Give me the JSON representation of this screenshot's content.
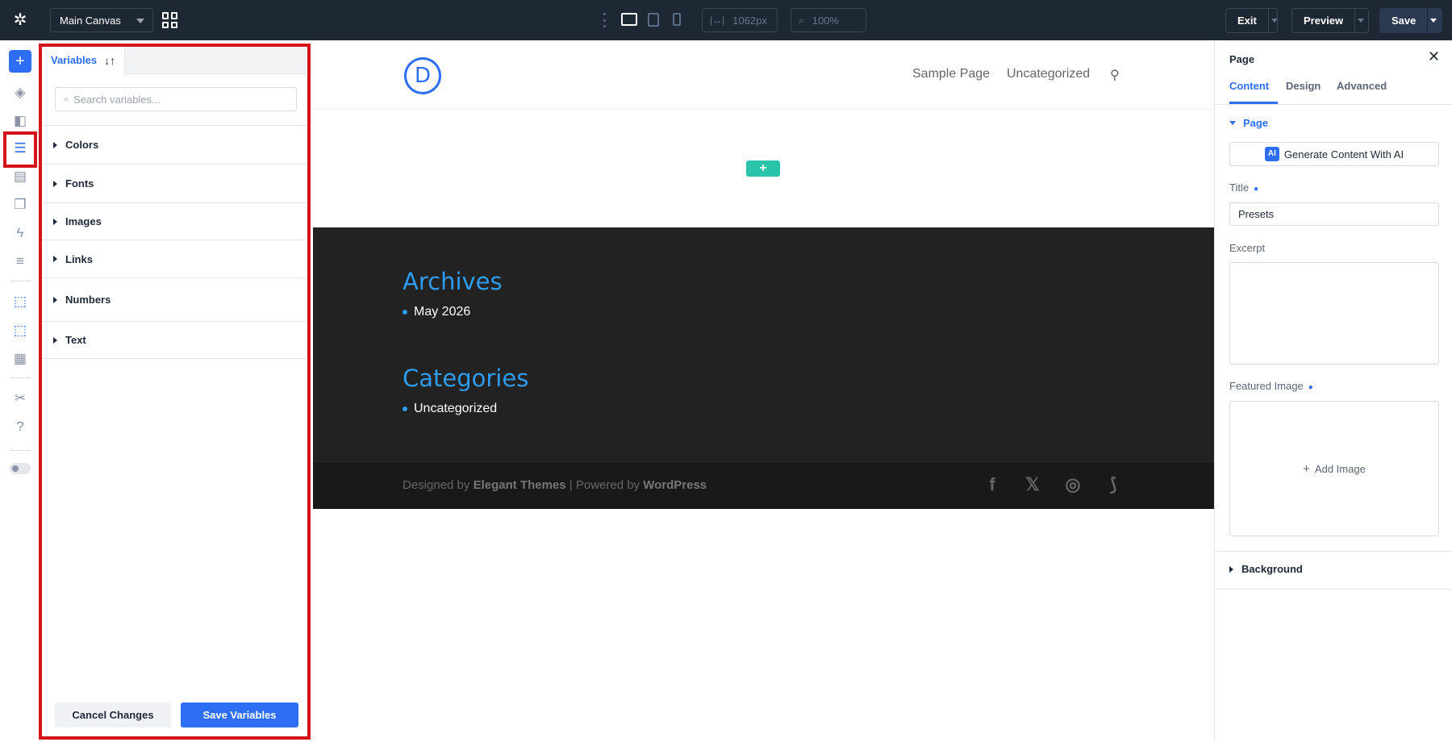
{
  "topbar": {
    "canvas_label": "Main Canvas",
    "width_value": "1062px",
    "zoom_value": "100%",
    "exit_label": "Exit",
    "preview_label": "Preview",
    "save_label": "Save"
  },
  "variables_panel": {
    "tab_label": "Variables",
    "search_placeholder": "Search variables...",
    "sections": [
      "Colors",
      "Fonts",
      "Images",
      "Links",
      "Numbers",
      "Text"
    ],
    "cancel_label": "Cancel Changes",
    "save_label": "Save Variables"
  },
  "preview": {
    "logo_letter": "D",
    "nav": [
      "Sample Page",
      "Uncategorized"
    ],
    "widgets": [
      {
        "title": "Archives",
        "items": [
          "May 2026"
        ]
      },
      {
        "title": "Categories",
        "items": [
          "Uncategorized"
        ]
      }
    ],
    "credits": {
      "designed_by": "Designed by ",
      "theme": "Elegant Themes",
      "powered_by": " | Powered by ",
      "platform": "WordPress"
    }
  },
  "settings": {
    "title": "Page",
    "tabs": [
      "Content",
      "Design",
      "Advanced"
    ],
    "group_title": "Page",
    "ai_badge": "AI",
    "ai_button": "Generate Content With AI",
    "title_label": "Title",
    "title_value": "Presets",
    "excerpt_label": "Excerpt",
    "featured_label": "Featured Image",
    "add_image_label": "Add Image",
    "background_label": "Background"
  },
  "colors": {
    "accent": "#2e6ef5",
    "topbar_bg": "#1e2734",
    "highlight": "#d4141b",
    "widget_title": "#2e9cf0",
    "footer_bg": "#222222",
    "add_section": "#29c4a9"
  },
  "icons": [
    "gear-icon",
    "layout-grid-icon",
    "layers-icon",
    "database-icon",
    "search-icon",
    "close-icon",
    "facebook-icon",
    "x-icon",
    "instagram-icon",
    "rss-icon"
  ]
}
